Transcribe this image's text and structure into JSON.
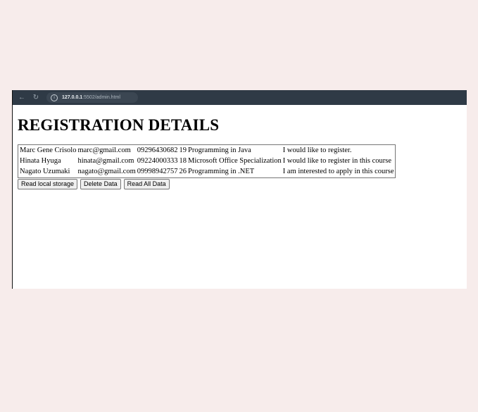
{
  "browser": {
    "url_host": "127.0.0.1",
    "url_path": ":5502/admin.html",
    "back_icon": "arrow-left-icon",
    "reload_icon": "reload-icon",
    "info_icon": "info-icon"
  },
  "page": {
    "title": "REGISTRATION DETAILS"
  },
  "table": {
    "rows": [
      {
        "name": "Marc Gene Crisolo",
        "email": "marc@gmail.com",
        "phone": "09296430682",
        "age": "19",
        "course": "Programming in Java",
        "message": "I would like to register."
      },
      {
        "name": "Hinata Hyuga",
        "email": "hinata@gmail.com",
        "phone": "09224000333",
        "age": "18",
        "course": "Microsoft Office Specialization",
        "message": "I would like to register in this course"
      },
      {
        "name": "Nagato Uzumaki",
        "email": "nagato@gmail.com",
        "phone": "09998942757",
        "age": "26",
        "course": "Programming in .NET",
        "message": "I am interested to apply in this course"
      }
    ]
  },
  "buttons": {
    "read_local": "Read local storage",
    "delete": "Delete Data",
    "read_all": "Read All Data"
  }
}
